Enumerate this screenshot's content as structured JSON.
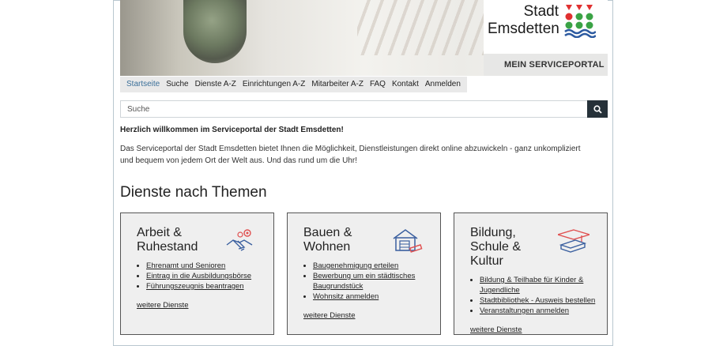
{
  "header": {
    "logo_line1": "Stadt",
    "logo_line2": "Emsdetten",
    "portal_label": "MEIN SERVICEPORTAL"
  },
  "nav": {
    "items": [
      "Startseite",
      "Suche",
      "Dienste A-Z",
      "Einrichtungen A-Z",
      "Mitarbeiter A-Z",
      "FAQ",
      "Kontakt",
      "Anmelden"
    ]
  },
  "search": {
    "placeholder": "Suche"
  },
  "welcome": "Herzlich willkommen im Serviceportal der Stadt Emsdetten!",
  "intro": "Das Serviceportal der Stadt Emsdetten bietet Ihnen die Möglichkeit, Dienstleistungen direkt online abzuwickeln - ganz unkompliziert und bequem von jedem Ort der Welt aus. Und das rund um die Uhr!",
  "section_title": "Dienste nach Themen",
  "cards": [
    {
      "title": "Arbeit & Ruhestand",
      "icon": "handshake-icon",
      "links": [
        "Ehrenamt und Senioren",
        "Eintrag in die Ausbildungsbörse",
        "Führungszeugnis beantragen"
      ],
      "more": "weitere Dienste"
    },
    {
      "title": "Bauen & Wohnen",
      "icon": "house-icon",
      "links": [
        "Baugenehmigung erteilen",
        "Bewerbung um ein städtisches Baugrundstück",
        "Wohnsitz anmelden"
      ],
      "more": "weitere Dienste"
    },
    {
      "title": "Bildung, Schule & Kultur",
      "icon": "graduation-cap-icon",
      "links": [
        "Bildung & Teilhabe für Kinder & Jugendliche",
        "Stadtbibliothek - Ausweis bestellen",
        "Veranstaltungen anmelden"
      ],
      "more": "weitere Dienste"
    }
  ],
  "colors": {
    "accent_red": "#e03030",
    "accent_green": "#3aa345",
    "accent_blue": "#2c5aa0",
    "search_button": "#263139",
    "active_nav": "#3a6f99"
  }
}
